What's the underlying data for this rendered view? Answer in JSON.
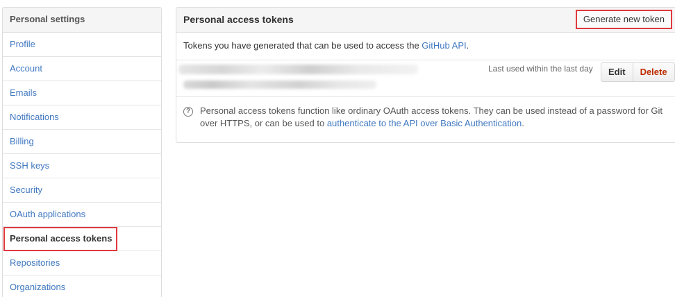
{
  "sidebar": {
    "header": "Personal settings",
    "items": [
      {
        "label": "Profile"
      },
      {
        "label": "Account"
      },
      {
        "label": "Emails"
      },
      {
        "label": "Notifications"
      },
      {
        "label": "Billing"
      },
      {
        "label": "SSH keys"
      },
      {
        "label": "Security"
      },
      {
        "label": "OAuth applications"
      },
      {
        "label": "Personal access tokens",
        "selected": true
      },
      {
        "label": "Repositories"
      },
      {
        "label": "Organizations"
      }
    ]
  },
  "main": {
    "title": "Personal access tokens",
    "generate_label": "Generate new token",
    "intro_prefix": "Tokens you have generated that can be used to access the ",
    "intro_link": "GitHub API",
    "intro_suffix": ".",
    "token": {
      "last_used": "Last used within the last day",
      "edit_label": "Edit",
      "delete_label": "Delete"
    },
    "note_prefix": "Personal access tokens function like ordinary OAuth access tokens. They can be used instead of a password for Git over HTTPS, or can be used to ",
    "note_link": "authenticate to the API over Basic Authentication",
    "note_suffix": ".",
    "help_icon_glyph": "?"
  },
  "colors": {
    "link": "#4078c0",
    "highlight": "#e0393e",
    "delete": "#bd2c00"
  }
}
